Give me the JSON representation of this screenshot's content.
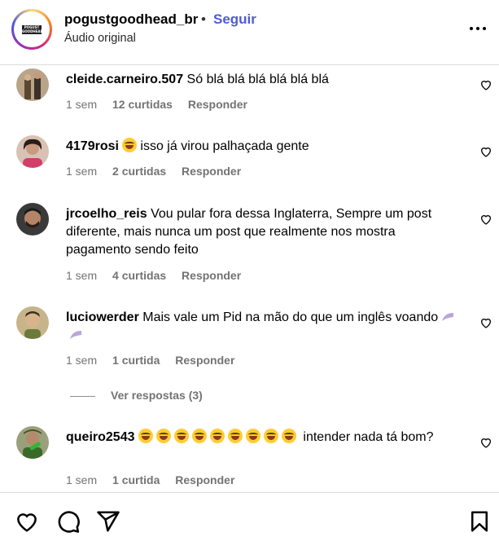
{
  "header": {
    "logo_text_line1": "POGUST",
    "logo_text_line2": "GOODHEAD",
    "username": "pogustgoodhead_br",
    "separator": "•",
    "follow_label": "Seguir",
    "audio_label": "Áudio original"
  },
  "comments": [
    {
      "user": "cleide.carneiro.507",
      "text": "Só blá blá blá blá blá blá",
      "time": "1 sem",
      "likes": "12 curtidas",
      "reply": "Responder"
    },
    {
      "user": "4179rosi",
      "text": "isso já virou palhaçada gente",
      "time": "1 sem",
      "likes": "2 curtidas",
      "reply": "Responder"
    },
    {
      "user": "jrcoelho_reis",
      "text": "Vou pular fora dessa Inglaterra, Sempre um post diferente, mais nunca um post que realmente nos mostra pagamento sendo feito",
      "time": "1 sem",
      "likes": "4 curtidas",
      "reply": "Responder"
    },
    {
      "user": "luciowerder",
      "text": "Mais vale um Pid na mão do que um inglês voando",
      "time": "1 sem",
      "likes": "1 curtida",
      "reply": "Responder"
    },
    {
      "user": "queiro2543",
      "text": "intender nada tá bom?",
      "time": "1 sem",
      "likes": "1 curtida",
      "reply": "Responder"
    }
  ],
  "view_replies": "Ver respostas (3)",
  "icons": {
    "more": "more-options-icon",
    "heart": "heart-icon",
    "comment": "comment-icon",
    "share": "share-icon",
    "save": "bookmark-icon",
    "emoji": "laughing-emoji-icon",
    "wings": "wings-icon"
  },
  "colors": {
    "follow": "#4f5bd5",
    "meta": "#737373",
    "divider": "#dbdbdb"
  }
}
